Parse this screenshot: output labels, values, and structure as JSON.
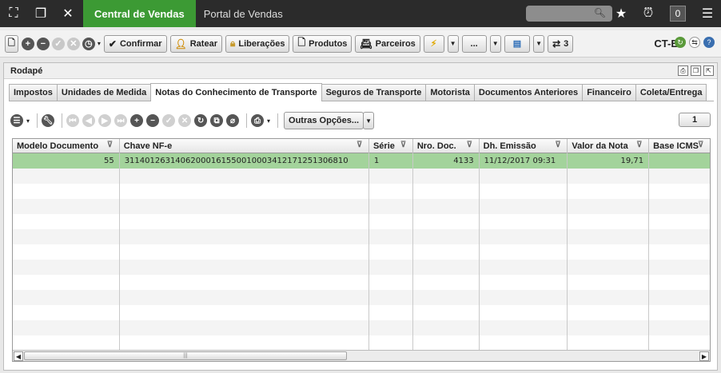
{
  "topbar": {
    "tabs": [
      {
        "label": "Central de Vendas",
        "active": true
      },
      {
        "label": "Portal de Vendas",
        "active": false
      }
    ],
    "notification_count": "0"
  },
  "toolbar": {
    "confirm_label": "Confirmar",
    "ratear_label": "Ratear",
    "liberacoes_label": "Liberações",
    "produtos_label": "Produtos",
    "parceiros_label": "Parceiros",
    "more_label": "...",
    "count_label": "3",
    "doc_type": "CT-E"
  },
  "panel": {
    "title": "Rodapé",
    "tabs": [
      {
        "label": "Impostos"
      },
      {
        "label": "Unidades de Medida"
      },
      {
        "label": "Notas do Conhecimento de Transporte",
        "active": true
      },
      {
        "label": "Seguros de Transporte"
      },
      {
        "label": "Motorista"
      },
      {
        "label": "Documentos Anteriores"
      },
      {
        "label": "Financeiro"
      },
      {
        "label": "Coleta/Entrega"
      }
    ],
    "outras_opcoes": "Outras Opções...",
    "page": "1"
  },
  "grid": {
    "columns": [
      "Modelo Documento",
      "Chave NF-e",
      "Série",
      "Nro. Doc.",
      "Dh. Emissão",
      "Valor da Nota",
      "Base ICMS"
    ],
    "rows": [
      [
        "55",
        "31140126314062000161550010003412171251306810",
        "1",
        "4133",
        "11/12/2017 09:31",
        "19,71",
        ""
      ]
    ]
  },
  "colors": {
    "active_tab": "#3c9a34",
    "selected_row": "#a3d39b"
  }
}
